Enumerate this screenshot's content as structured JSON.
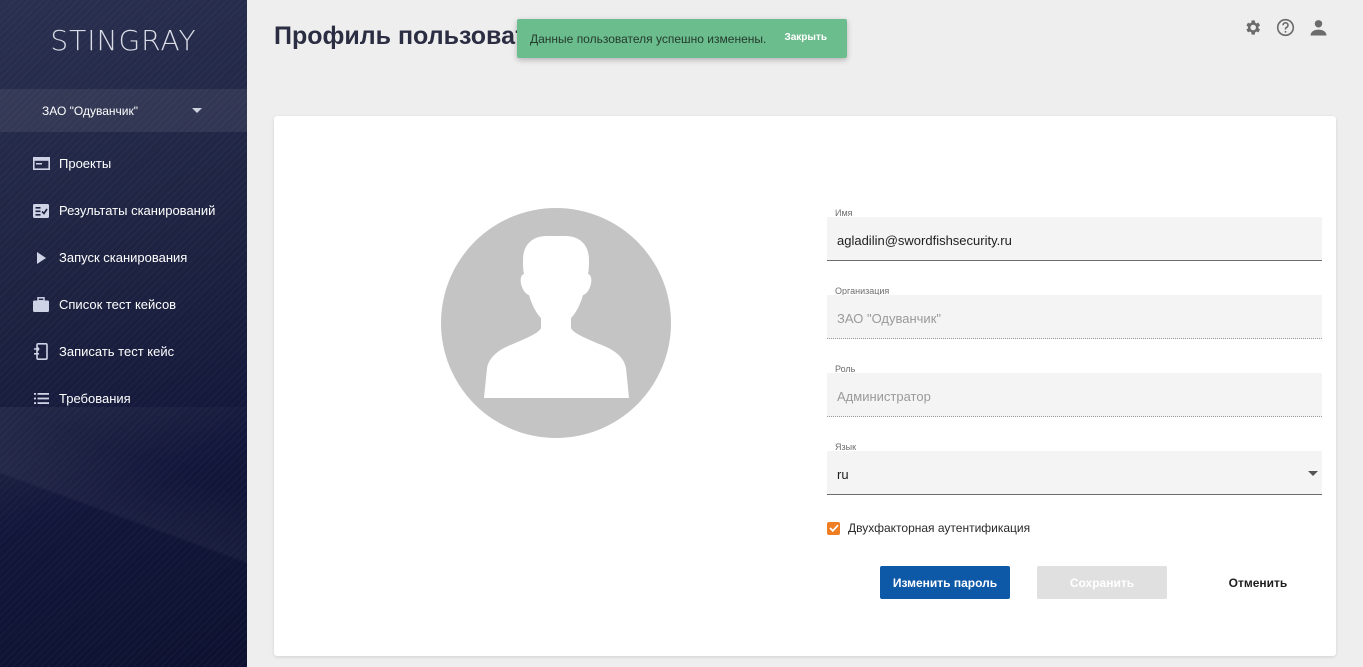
{
  "app": {
    "logo": "STINGRAY"
  },
  "sidebar": {
    "org_selector": "ЗАО \"Одуванчик\"",
    "items": [
      {
        "label": "Проекты",
        "icon": "projects-icon"
      },
      {
        "label": "Результаты сканирований",
        "icon": "scan-results-icon"
      },
      {
        "label": "Запуск сканирования",
        "icon": "play-icon"
      },
      {
        "label": "Список тест кейсов",
        "icon": "briefcase-icon"
      },
      {
        "label": "Записать тест кейс",
        "icon": "record-icon"
      },
      {
        "label": "Требования",
        "icon": "list-icon"
      }
    ]
  },
  "header": {
    "title": "Профиль пользовате",
    "icons": [
      "settings-icon",
      "help-icon",
      "user-icon"
    ]
  },
  "toast": {
    "message": "Данные пользователя успешно изменены.",
    "close_label": "Закрыть",
    "color": "#6cbd8e"
  },
  "form": {
    "name": {
      "label": "Имя",
      "value": "agladilin@swordfishsecurity.ru"
    },
    "organization": {
      "label": "Организация",
      "value": "ЗАО \"Одуванчик\""
    },
    "role": {
      "label": "Роль",
      "value": "Администратор"
    },
    "language": {
      "label": "Язык",
      "value": "ru"
    },
    "two_factor": {
      "label": "Двухфакторная аутентификация",
      "checked": true
    }
  },
  "buttons": {
    "change_password": "Изменить пароль",
    "save": "Сохранить",
    "cancel": "Отменить"
  },
  "colors": {
    "primary": "#0e58a8",
    "checkbox": "#ef7d22",
    "sidebar": "#1c2140"
  }
}
